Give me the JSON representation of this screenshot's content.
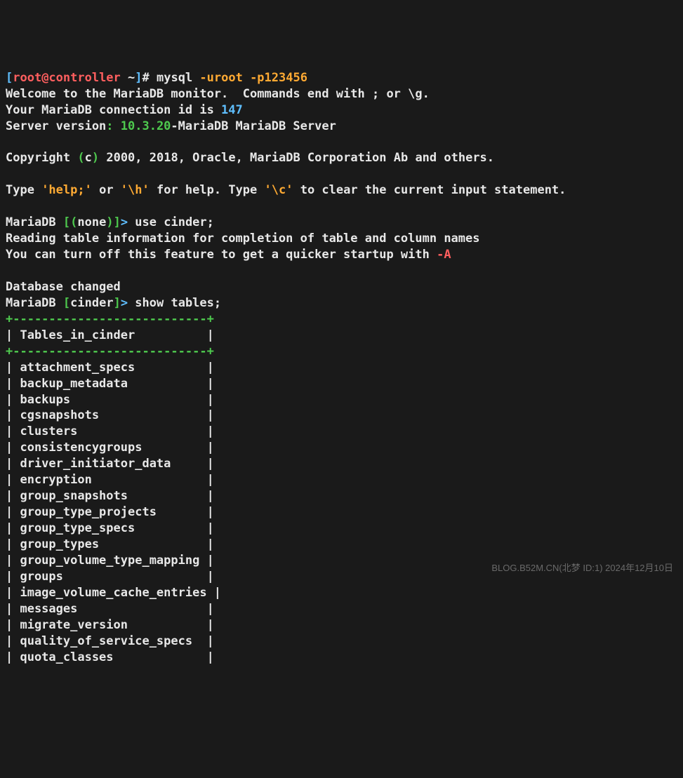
{
  "prompt1": {
    "br1": "[",
    "user": "root@controller",
    "tilde": " ~",
    "br2": "]",
    "hash": "# ",
    "cmd": "mysql ",
    "args": "-uroot -p123456"
  },
  "welcome": {
    "l1": "Welcome to the MariaDB monitor.  Commands end with ; or \\g.",
    "l2a": "Your MariaDB connection id is ",
    "l2b": "147",
    "l3a": "Server version",
    "l3b": ": 10.3.20",
    "l3c": "-MariaDB MariaDB Server"
  },
  "copyright": {
    "a": "Copyright ",
    "b": "(",
    "c": "c",
    "d": ")",
    "e": " 2000, 2018, Oracle, MariaDB Corporation Ab and others."
  },
  "help": {
    "a": "Type ",
    "b": "'help;'",
    "c": " or ",
    "d": "'\\h'",
    "e": " for help. Type ",
    "f": "'\\c'",
    "g": " to clear the current input statement."
  },
  "prompt_none": {
    "a": "MariaDB ",
    "b": "[(",
    "c": "none",
    "d": ")]",
    "e": "> ",
    "cmd": "use cinder;"
  },
  "reading": {
    "l1": "Reading table information for completion of table and column names",
    "l2a": "You can turn off this feature to get a quicker startup with ",
    "l2b": "-A"
  },
  "db_changed": "Database changed",
  "prompt_cinder": {
    "a": "MariaDB ",
    "b": "[",
    "c": "cinder",
    "d": "]",
    "e": "> ",
    "cmd": "show tables;"
  },
  "table": {
    "border_top": "+---------------------------+",
    "header": "| Tables_in_cinder          |",
    "border_mid": "+---------------------------+",
    "rows": [
      "| attachment_specs          |",
      "| backup_metadata           |",
      "| backups                   |",
      "| cgsnapshots               |",
      "| clusters                  |",
      "| consistencygroups         |",
      "| driver_initiator_data     |",
      "| encryption                |",
      "| group_snapshots           |",
      "| group_type_projects       |",
      "| group_type_specs          |",
      "| group_types               |",
      "| group_volume_type_mapping |",
      "| groups                    |",
      "| image_volume_cache_entries |",
      "| messages                  |",
      "| migrate_version           |",
      "| quality_of_service_specs  |",
      "| quota_classes             |"
    ]
  },
  "watermark": "BLOG.B52M.CN(北梦 ID:1) 2024年12月10日"
}
